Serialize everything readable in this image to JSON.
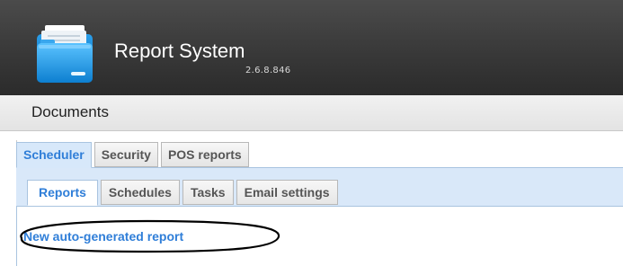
{
  "app": {
    "title": "Report System",
    "version": "2.6.8.846"
  },
  "section": {
    "title": "Documents"
  },
  "outer_tabs": [
    {
      "label": "Scheduler",
      "active": true
    },
    {
      "label": "Security",
      "active": false
    },
    {
      "label": "POS reports",
      "active": false
    }
  ],
  "inner_tabs": [
    {
      "label": "Reports",
      "active": true
    },
    {
      "label": "Schedules",
      "active": false
    },
    {
      "label": "Tasks",
      "active": false
    },
    {
      "label": "Email settings",
      "active": false
    }
  ],
  "reports": {
    "new_link_label": "New auto-generated report"
  },
  "colors": {
    "header_bg": "#3c3c3c",
    "accent": "#2f7ed8",
    "tab_panel_bg": "#d9e8f9",
    "logo_blue": "#1e9be6"
  },
  "icons": {
    "logo": "folder-document-icon"
  }
}
